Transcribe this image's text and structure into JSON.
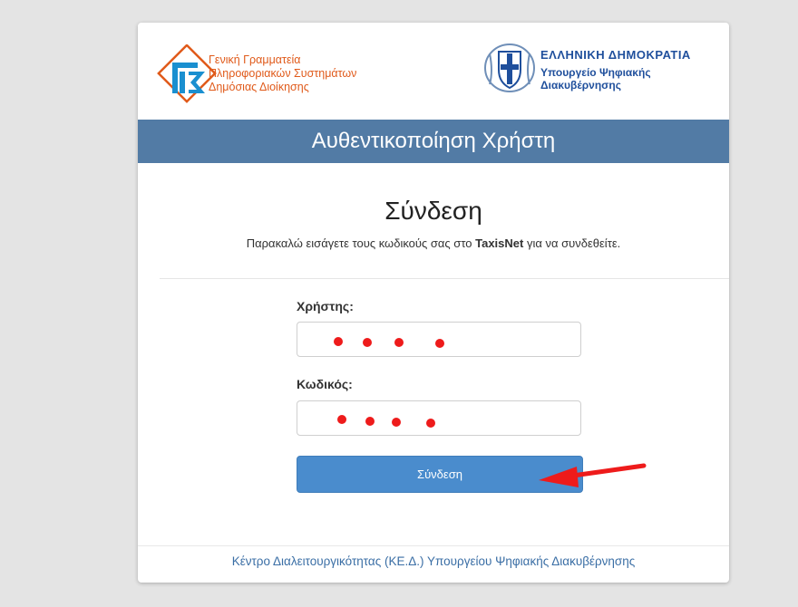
{
  "header": {
    "left_logo_lines": [
      "Γενική Γραμματεία",
      "Πληροφοριακών Συστημάτων",
      "Δημόσιας Διοίκησης"
    ],
    "right_title": "ΕΛΛΗΝΙΚΗ ΔΗΜΟΚΡΑΤΙΑ",
    "right_sub_lines": [
      "Υπουργείο Ψηφιακής",
      "Διακυβέρνησης"
    ]
  },
  "banner": {
    "title": "Αυθεντικοποίηση Χρήστη"
  },
  "login": {
    "heading": "Σύνδεση",
    "instruction_prefix": "Παρακαλώ εισάγετε τους κωδικούς σας στο ",
    "instruction_brand": "TaxisNet",
    "instruction_suffix": " για να συνδεθείτε.",
    "username_label": "Χρήστης:",
    "password_label": "Κωδικός:",
    "submit_label": "Σύνδεση"
  },
  "footer": {
    "text": "Κέντρο Διαλειτουργικότητας (ΚΕ.Δ.) Υπουργείου Ψηφιακής Διακυβέρνησης"
  },
  "icons": {
    "left_logo": "ggpsdd-logo-icon",
    "emblem": "greek-coat-of-arms-icon",
    "arrow": "red-arrow-annotation-icon"
  },
  "colors": {
    "banner": "#527ba5",
    "button": "#4a8ccd",
    "annotation_red": "#ee1b1b",
    "left_logo_orange": "#e05a1a",
    "ministry_blue": "#1f4f9c"
  }
}
